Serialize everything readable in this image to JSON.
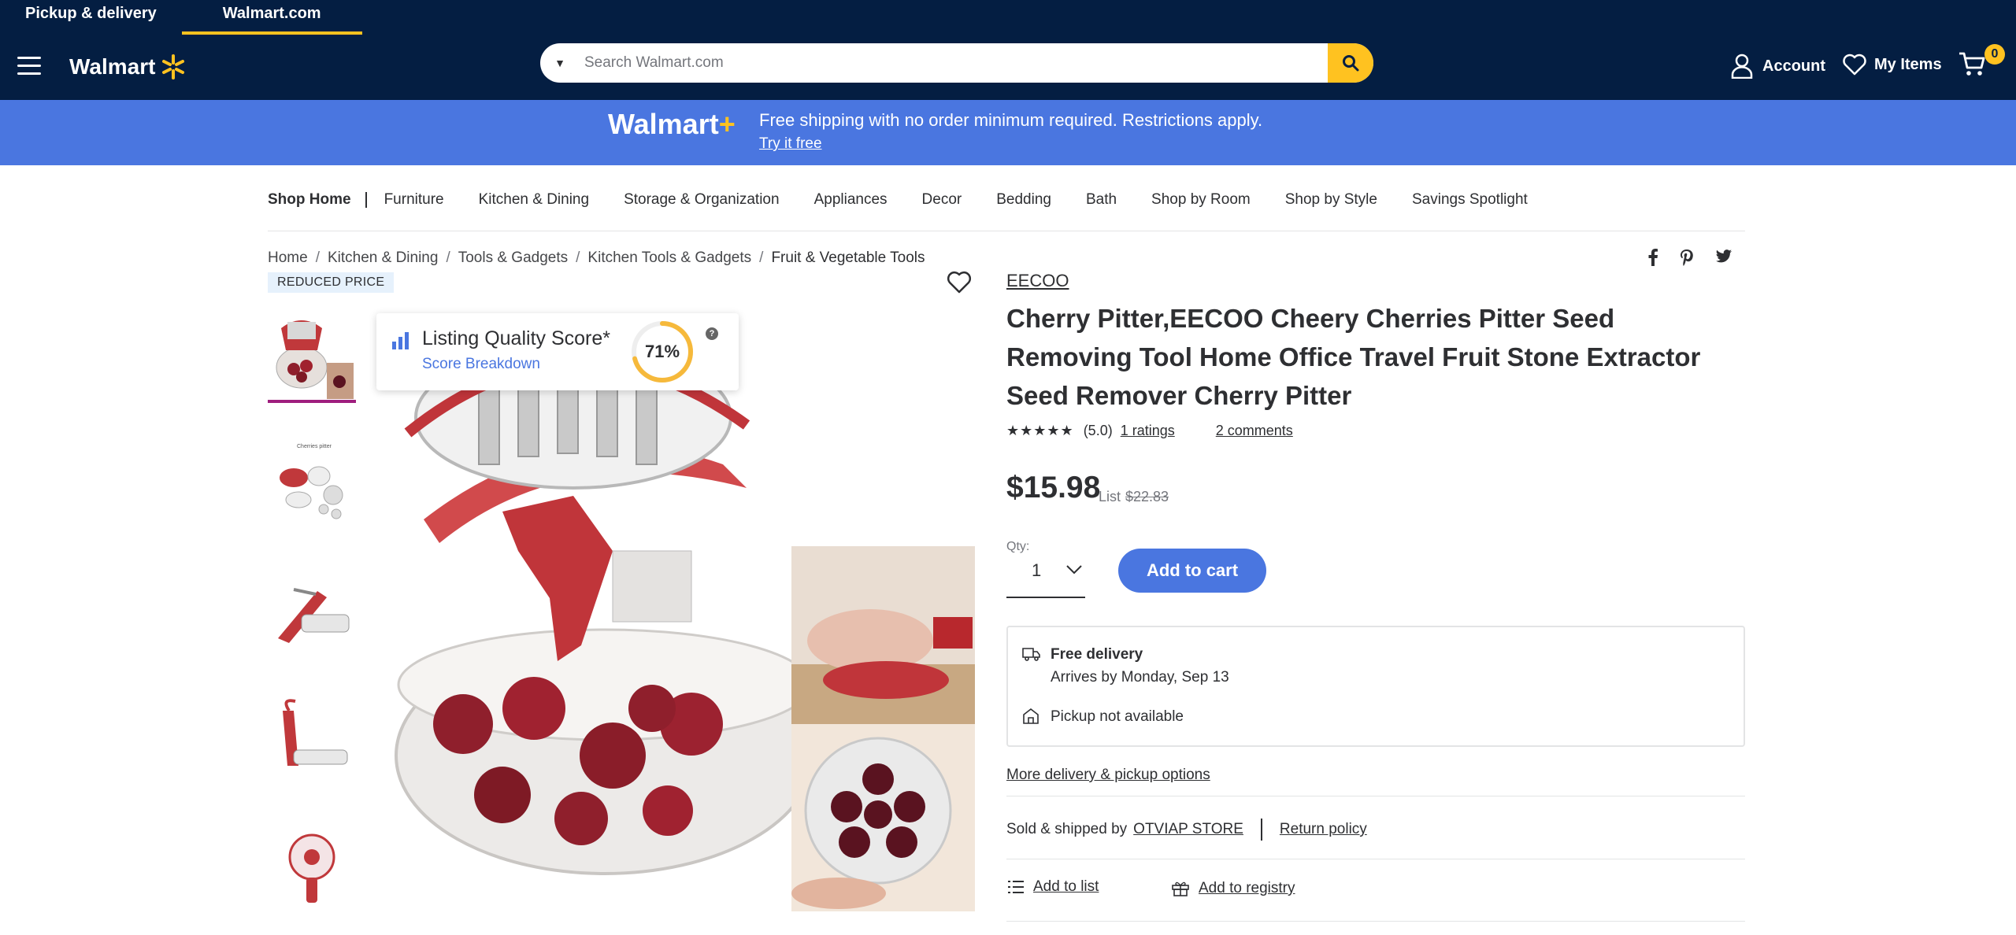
{
  "header": {
    "tabs": [
      {
        "label": "Pickup & delivery"
      },
      {
        "label": "Walmart.com"
      }
    ],
    "logo_text": "Walmart",
    "search": {
      "placeholder": "Search Walmart.com"
    },
    "account_label": "Account",
    "my_items_label": "My Items",
    "cart_count": "0"
  },
  "banner": {
    "logo_text": "Walmart",
    "logo_plus": "+",
    "message": "Free shipping with no order minimum required. Restrictions apply.",
    "link": "Try it free"
  },
  "category_nav": {
    "shop_label": "Shop Home",
    "items": [
      "Furniture",
      "Kitchen & Dining",
      "Storage & Organization",
      "Appliances",
      "Decor",
      "Bedding",
      "Bath",
      "Shop by Room",
      "Shop by Style",
      "Savings Spotlight"
    ]
  },
  "breadcrumb": [
    "Home",
    "Kitchen & Dining",
    "Tools & Gadgets",
    "Kitchen Tools & Gadgets",
    "Fruit & Vegetable Tools"
  ],
  "badge": "REDUCED PRICE",
  "score_card": {
    "title": "Listing Quality Score*",
    "link": "Score Breakdown",
    "percent_label": "71%",
    "percent": 71,
    "help": "?"
  },
  "product": {
    "brand": "EECOO",
    "title": "Cherry Pitter,EECOO Cheery Cherries Pitter Seed Removing Tool Home Office Travel Fruit Stone Extractor Seed Remover Cherry Pitter",
    "stars": "★★★★★",
    "rating_value": "(5.0)",
    "ratings_link": "1 ratings",
    "comments_link": "2 comments",
    "price": "$15.98",
    "list_label": "List",
    "list_price": "$22.83",
    "qty_label": "Qty:",
    "qty_value": "1",
    "add_to_cart": "Add to cart"
  },
  "delivery": {
    "free_title": "Free delivery",
    "arrives": "Arrives by Monday, Sep 13",
    "pickup": "Pickup not available",
    "more_link": "More delivery & pickup options"
  },
  "seller": {
    "sold_label": "Sold & shipped by",
    "store": "OTVIAP STORE",
    "return_policy": "Return policy"
  },
  "actions": {
    "add_to_list": "Add to list",
    "add_to_registry": "Add to registry"
  },
  "colors": {
    "navy": "#041e42",
    "yellow": "#ffc220",
    "blue": "#4a76e0",
    "magenta": "#9f1e7e"
  }
}
